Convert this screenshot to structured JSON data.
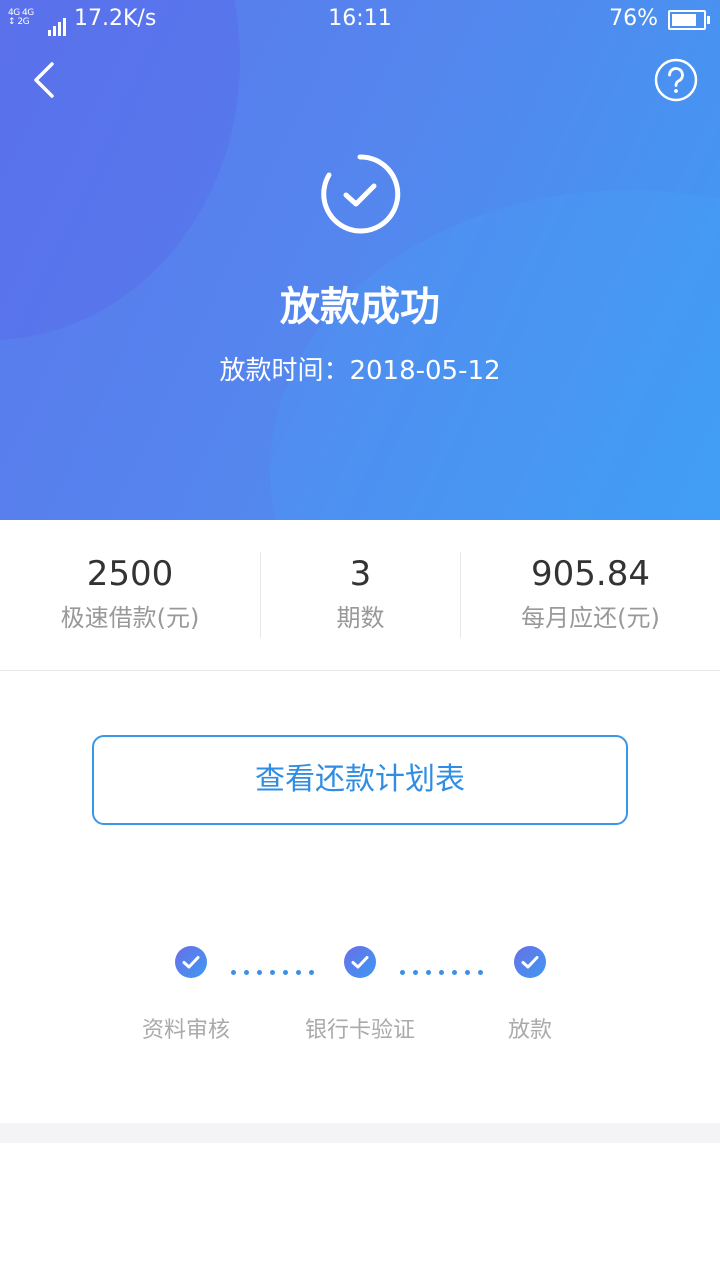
{
  "status_bar": {
    "network": "4G 4G 2G",
    "speed": "17.2K/s",
    "time": "16:11",
    "battery_percent": "76%",
    "battery_level": 0.76
  },
  "nav": {
    "back_icon": "chevron-left-icon",
    "help_icon": "question-circle-icon"
  },
  "hero": {
    "icon": "check-circle-icon",
    "title": "放款成功",
    "subtitle": "放款时间：2018-05-12",
    "gradient": [
      "#5b78ec",
      "#3f9cf3"
    ]
  },
  "stats": [
    {
      "value": "2500",
      "label": "极速借款(元)"
    },
    {
      "value": "3",
      "label": "期数"
    },
    {
      "value": "905.84",
      "label": "每月应还(元)"
    }
  ],
  "plan_button": {
    "label": "查看还款计划表",
    "color": "#2f8de4"
  },
  "steps": [
    {
      "label": "资料审核",
      "icon": "check-badge-icon",
      "done": true
    },
    {
      "label": "银行卡验证",
      "icon": "check-badge-icon",
      "done": true
    },
    {
      "label": "放款",
      "icon": "check-badge-icon",
      "done": true
    }
  ]
}
